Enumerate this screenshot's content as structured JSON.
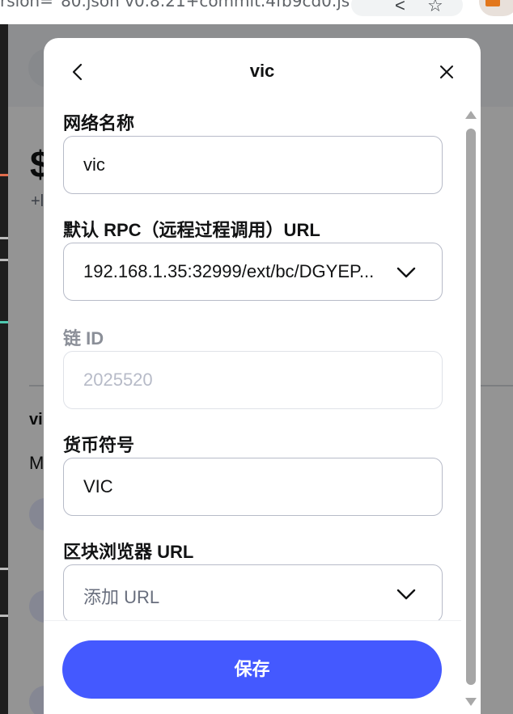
{
  "browser": {
    "url_fragment": "rsion=\"80.json v0.8.21+commit.4fb9cd0.js",
    "back_glyph": "<",
    "star_glyph": "☆"
  },
  "background_page": {
    "balance_fragment": "$",
    "change_fragment": "+l",
    "network_label_fragment": "vi",
    "section_label_fragment": "M"
  },
  "modal": {
    "title": "vic",
    "fields": {
      "network_name": {
        "label": "网络名称",
        "value": "vic"
      },
      "rpc_url": {
        "label": "默认 RPC（远程过程调用）URL",
        "value": "192.168.1.35:32999/ext/bc/DGYEP..."
      },
      "chain_id": {
        "label": "链 ID",
        "placeholder": "2025520"
      },
      "currency_symbol": {
        "label": "货币符号",
        "value": "VIC"
      },
      "block_explorer": {
        "label": "区块浏览器 URL",
        "placeholder": "添加 URL"
      }
    },
    "save_label": "保存"
  },
  "colors": {
    "primary": "#4459ff",
    "text": "#121314",
    "muted": "#686e7d",
    "border": "#b7bbc8"
  },
  "icons": {
    "back": "chevron-left-icon",
    "close": "close-icon",
    "dropdown": "chevron-down-icon"
  }
}
